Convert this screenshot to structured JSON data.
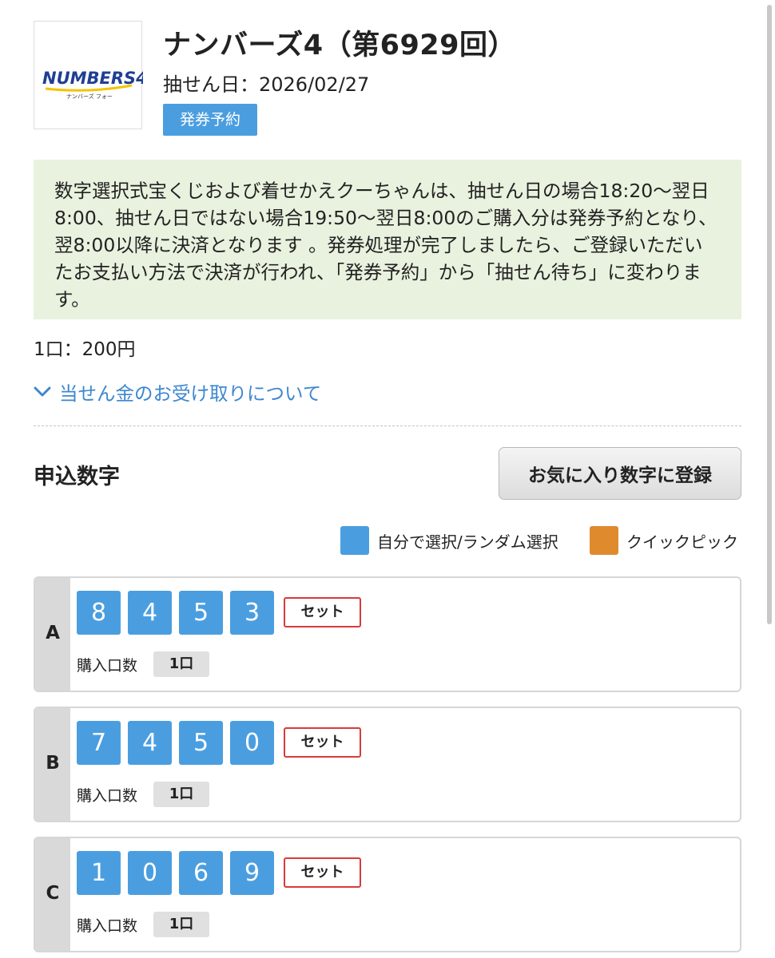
{
  "header": {
    "logo_text": "NUMBERS4",
    "logo_subtext": "ナンバーズ フォー",
    "title": "ナンバーズ4（第6929回）",
    "draw_date": "抽せん日：2026/02/27",
    "status_badge": "発券予約"
  },
  "notice": {
    "text": "数字選択式宝くじおよび着せかえクーちゃんは、抽せん日の場合18:20〜翌日8:00、抽せん日ではない場合19:50〜翌日8:00のご購入分は発券予約となり、翌8:00以降に決済となります 。発券処理が完了しましたら、ご登録いただいたお支払い方法で決済が行われ、「発券予約」から「抽せん待ち」に変わります。"
  },
  "price": "1口：200円",
  "prize_link": "当せん金のお受け取りについて",
  "section": {
    "title": "申込数字",
    "favorite_button": "お気に入り数字に登録"
  },
  "legend": {
    "manual_label": "自分で選択/ランダム選択",
    "quick_label": "クイックピック",
    "manual_color": "#4a9ee0",
    "quick_color": "#e08a2e"
  },
  "entries": [
    {
      "letter": "A",
      "digits": [
        "8",
        "4",
        "5",
        "3"
      ],
      "type_label": "セット",
      "qty_label": "購入口数",
      "qty_value": "1口"
    },
    {
      "letter": "B",
      "digits": [
        "7",
        "4",
        "5",
        "0"
      ],
      "type_label": "セット",
      "qty_label": "購入口数",
      "qty_value": "1口"
    },
    {
      "letter": "C",
      "digits": [
        "1",
        "0",
        "6",
        "9"
      ],
      "type_label": "セット",
      "qty_label": "購入口数",
      "qty_value": "1口"
    }
  ]
}
